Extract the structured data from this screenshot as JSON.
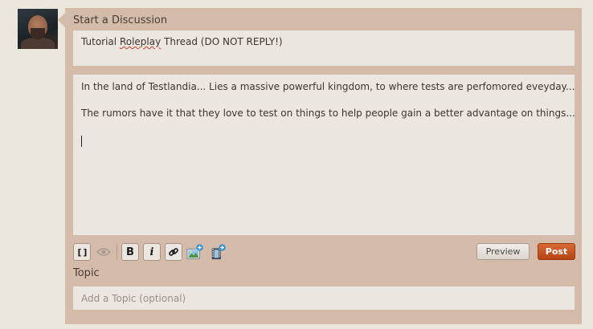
{
  "form": {
    "heading": "Start a Discussion",
    "title_before": "Tutorial ",
    "title_spell": "Roleplay",
    "title_after": " Thread (DO NOT REPLY!)",
    "body_para_1": "In the land of Testlandia... Lies a massive powerful kingdom, to where tests are perfomored eveyday...",
    "body_para_2": "The rumors have it that they love to test on things to help people gain a better advantage on things...",
    "topic_label": "Topic",
    "topic_placeholder": "Add a Topic (optional)",
    "topic_value": ""
  },
  "toolbar": {
    "code_glyph": "[ ]",
    "bold_glyph": "B",
    "italic_glyph": "i",
    "preview_label": "Preview",
    "post_label": "Post",
    "icons": [
      "source-mode-icon",
      "preview-eye-icon",
      "bold-icon",
      "italic-icon",
      "link-icon",
      "add-image-icon",
      "add-video-icon"
    ]
  },
  "colors": {
    "panel": "#d5bbaa",
    "field": "#ebe6df",
    "post_button": "#c2521f",
    "add_badge": "#2d8fd6"
  }
}
